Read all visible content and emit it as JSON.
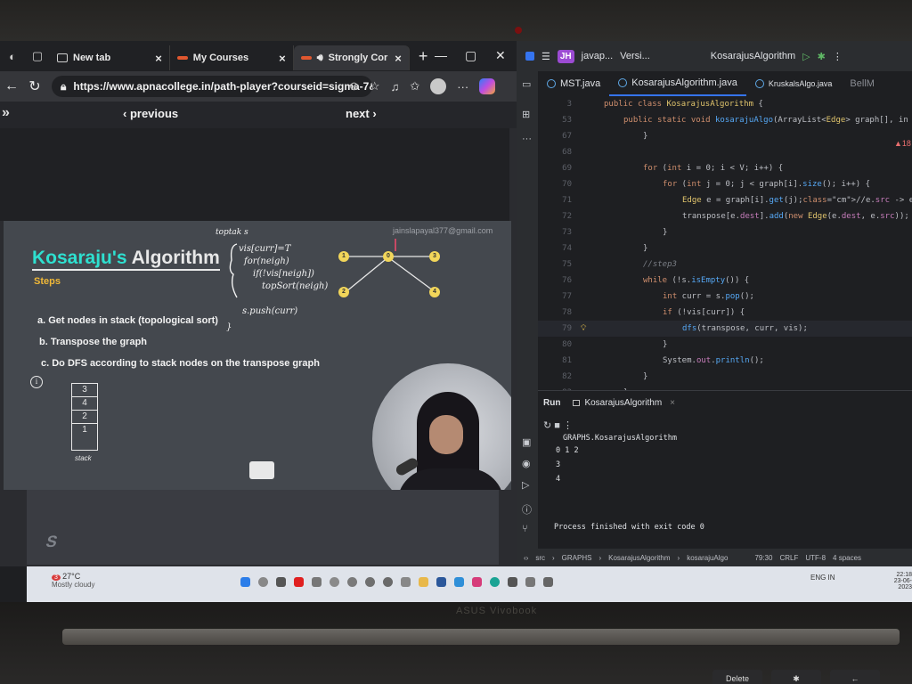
{
  "browser": {
    "tabs": [
      {
        "label": "New tab",
        "active": false,
        "fav_color": "#cfcfcf"
      },
      {
        "label": "My Courses",
        "active": false,
        "fav_color": "#e0572f"
      },
      {
        "label": "Strongly Cor",
        "active": true,
        "fav_color": "#e0572f"
      }
    ],
    "url": "https://www.apnacollege.in/path-player?courseid=sigma-7&...",
    "nav": {
      "previous": "‹ previous",
      "next": "next ›"
    }
  },
  "slide": {
    "title_highlight": "Kosaraju's",
    "title_rest": "Algorithm",
    "steps_heading": "Steps",
    "steps": [
      "a. Get nodes in stack (topological sort)",
      "b. Transpose the graph",
      "c. Do DFS according to stack nodes on the transpose graph"
    ],
    "email": "jainslapayal377@gmail.com",
    "stack_items": [
      "3",
      "4",
      "2",
      "1"
    ],
    "stack_label": "stack",
    "graph_nodes": [
      "1",
      "0",
      "3",
      "2",
      "4"
    ],
    "handwriting": {
      "top": "toptak s",
      "vis": "vis[curr]=T",
      "for": "for(neigh)",
      "if": "if(!vis[neigh])",
      "topsort": "topSort(neigh)",
      "push": "s.push(curr)",
      "brace": "}"
    }
  },
  "ide": {
    "project": "javap...",
    "version": "Versi...",
    "run_config": "KosarajusAlgorithm",
    "tabs": [
      {
        "label": "MST.java",
        "active": false
      },
      {
        "label": "KosarajusAlgorithm.java",
        "active": true
      },
      {
        "label": "KruskalsAlgo.java",
        "active": false
      },
      {
        "label": "BellM",
        "active": false
      }
    ],
    "warning_count": "▲18",
    "code_lines": [
      {
        "n": "3",
        "indent": 0,
        "text": "public class KosarajusAlgorithm {"
      },
      {
        "n": "53",
        "indent": 1,
        "text": "public static void kosarajuAlgo(ArrayList<Edge> graph[], in"
      },
      {
        "n": "67",
        "indent": 2,
        "text": "}"
      },
      {
        "n": "68",
        "indent": 0,
        "text": ""
      },
      {
        "n": "69",
        "indent": 2,
        "text": "for (int i = 0; i < V; i++) {"
      },
      {
        "n": "70",
        "indent": 3,
        "text": "for (int j = 0; j < graph[i].size(); i++) {"
      },
      {
        "n": "71",
        "indent": 4,
        "text": "Edge e = graph[i].get(j);//e.src -> e.dest"
      },
      {
        "n": "72",
        "indent": 4,
        "text": "transpose[e.dest].add(new Edge(e.dest, e.src));"
      },
      {
        "n": "73",
        "indent": 3,
        "text": "}"
      },
      {
        "n": "74",
        "indent": 2,
        "text": "}"
      },
      {
        "n": "75",
        "indent": 2,
        "text": "//step3"
      },
      {
        "n": "76",
        "indent": 2,
        "text": "while (!s.isEmpty()) {"
      },
      {
        "n": "77",
        "indent": 3,
        "text": "int curr = s.pop();"
      },
      {
        "n": "78",
        "indent": 3,
        "text": "if (!vis[curr]) {"
      },
      {
        "n": "79",
        "indent": 4,
        "text": "dfs(transpose, curr, vis);"
      },
      {
        "n": "80",
        "indent": 3,
        "text": "}"
      },
      {
        "n": "81",
        "indent": 3,
        "text": "System.out.println();"
      },
      {
        "n": "82",
        "indent": 2,
        "text": "}"
      },
      {
        "n": "83",
        "indent": 1,
        "text": "}"
      },
      {
        "n": "84",
        "indent": 1,
        "text": "public static void main(String args[]) {"
      }
    ],
    "run": {
      "title": "Run",
      "tab": "KosarajusAlgorithm",
      "output": [
        "GRAPHS.KosarajusAlgorithm",
        "0 1 2",
        "3",
        "4",
        "",
        "",
        "",
        "Process finished with exit code 0"
      ]
    },
    "status": {
      "path": [
        "src",
        "GRAPHS",
        "KosarajusAlgorithm",
        "kosarajuAlgo"
      ],
      "position": "79:30",
      "line_sep": "CRLF",
      "encoding": "UTF-8",
      "indent": "4 spaces"
    }
  },
  "taskbar": {
    "temp": "27°C",
    "weather": "Mostly cloudy",
    "lang": "ENG IN",
    "time": "22:18",
    "date": "23-06-2023",
    "notif": "3"
  },
  "laptop": {
    "brand": "ASUS Vivobook",
    "keys": [
      "Delete",
      "✱",
      "←"
    ]
  }
}
